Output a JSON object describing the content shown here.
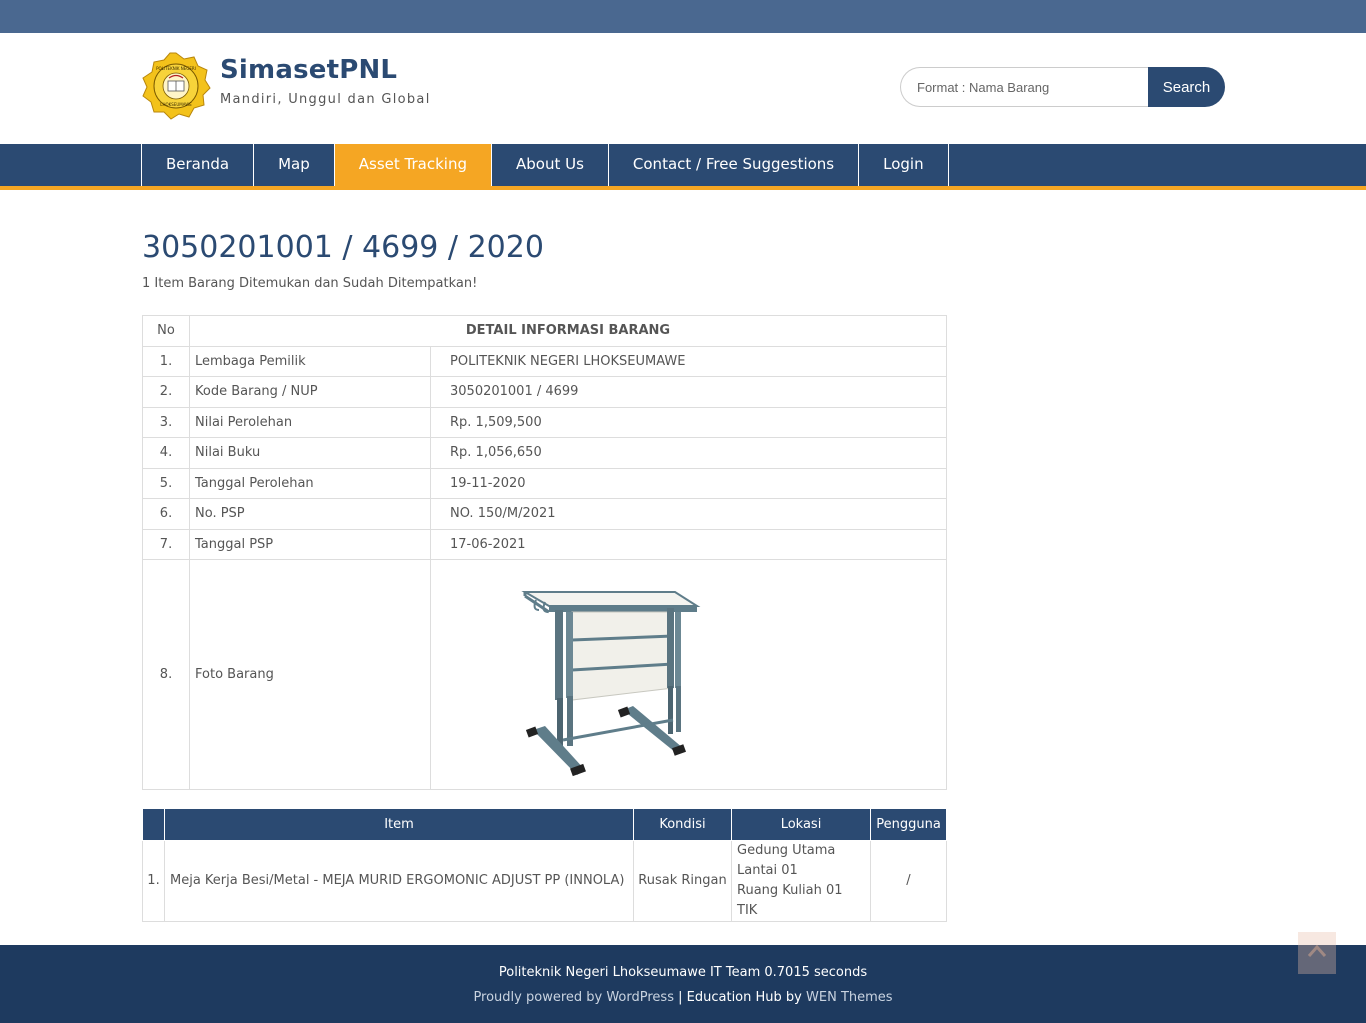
{
  "site": {
    "title": "SimasetPNL",
    "tagline": "Mandiri, Unggul dan Global",
    "logo_icon": "pnl-seal-logo",
    "logo_text_top": "POLITEKNIK NEGERI",
    "logo_text_bottom": "LHOKSEUMAWE"
  },
  "search": {
    "placeholder": "Format : Nama Barang",
    "button_label": "Search"
  },
  "nav": {
    "items": [
      {
        "label": "Beranda"
      },
      {
        "label": "Map"
      },
      {
        "label": "Asset Tracking",
        "active": true
      },
      {
        "label": "About Us"
      },
      {
        "label": "Contact / Free Suggestions"
      },
      {
        "label": "Login"
      }
    ]
  },
  "page": {
    "title": "3050201001 / 4699 / 2020",
    "subtitle": "1 Item Barang Ditemukan dan Sudah Ditempatkan!"
  },
  "detail": {
    "header_no": "No",
    "header_title": "DETAIL INFORMASI BARANG",
    "rows": [
      {
        "no": "1.",
        "label": "Lembaga Pemilik",
        "value": "POLITEKNIK NEGERI LHOKSEUMAWE"
      },
      {
        "no": "2.",
        "label": "Kode Barang / NUP",
        "value": "3050201001 / 4699"
      },
      {
        "no": "3.",
        "label": "Nilai Perolehan",
        "value": "Rp. 1,509,500"
      },
      {
        "no": "4.",
        "label": "Nilai Buku",
        "value": "Rp. 1,056,650"
      },
      {
        "no": "5.",
        "label": "Tanggal Perolehan",
        "value": "19-11-2020"
      },
      {
        "no": "6.",
        "label": "No. PSP",
        "value": "NO. 150/M/2021"
      },
      {
        "no": "7.",
        "label": "Tanggal PSP",
        "value": "17-06-2021"
      }
    ],
    "photo_row": {
      "no": "8.",
      "label": "Foto Barang",
      "image_icon": "desk-photo"
    }
  },
  "items": {
    "headers": {
      "no": "",
      "item": "Item",
      "kondisi": "Kondisi",
      "lokasi": "Lokasi",
      "pengguna": "Pengguna"
    },
    "rows": [
      {
        "no": "1.",
        "item": "Meja Kerja Besi/Metal - MEJA MURID ERGOMONIC ADJUST PP (INNOLA)",
        "kondisi": "Rusak Ringan",
        "lokasi_1": "Gedung Utama",
        "lokasi_2": "Lantai 01",
        "lokasi_3": "Ruang Kuliah 01 TIK",
        "pengguna": "/"
      }
    ]
  },
  "footer": {
    "line1": "Politeknik Negeri Lhokseumawe IT Team 0.7015 seconds",
    "powered": "Proudly powered by WordPress",
    "separator": "|",
    "theme_name": "Education Hub",
    "by": "by",
    "theme_author": "WEN Themes"
  },
  "scroll_top_icon": "chevron-up-icon"
}
